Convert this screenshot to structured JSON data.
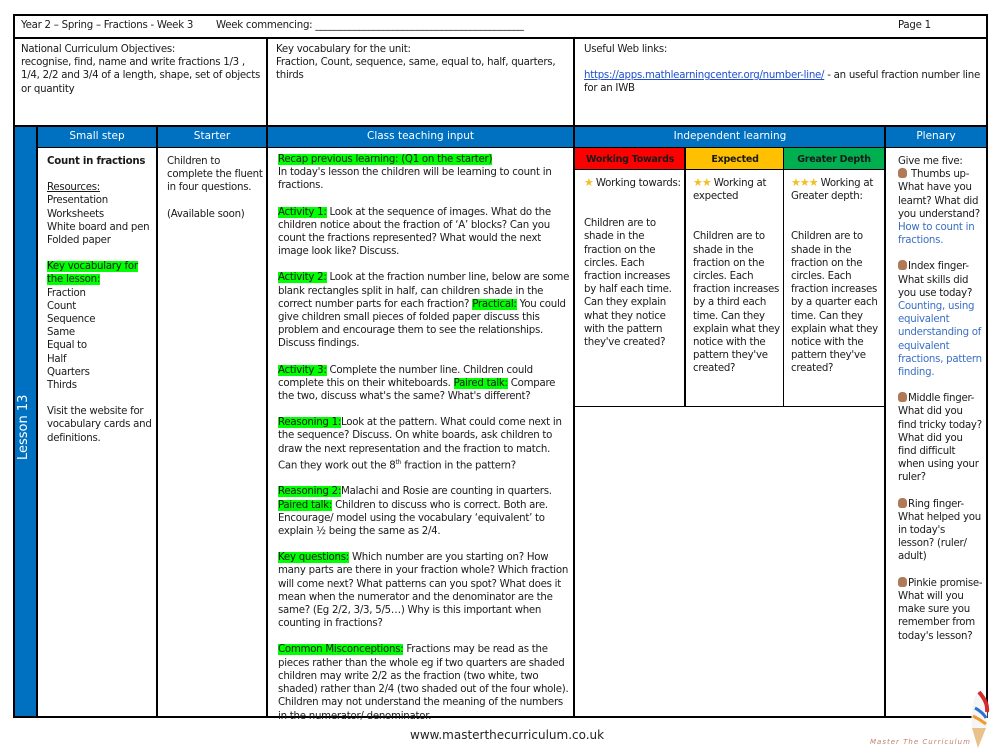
{
  "header": {
    "title": "Year 2 – Spring – Fractions - Week 3",
    "week_commencing_label": "Week commencing: ___________________________________________",
    "page": "Page 1"
  },
  "objectives": {
    "label": "National Curriculum Objectives:",
    "text": "recognise, find, name and write fractions 1/3 , 1/4, 2/2 and 3/4 of a length, shape, set of objects or quantity"
  },
  "unit_vocab": {
    "label": "Key vocabulary for the unit:",
    "text": "Fraction, Count, sequence, same, equal to, half, quarters, thirds"
  },
  "web_links": {
    "label": "Useful Web links:",
    "url": "https://apps.mathlearningcenter.org/number-line/",
    "desc": " - an useful fraction number line for an IWB"
  },
  "lesson_label": "Lesson 13",
  "columns": {
    "small_step": "Small step",
    "starter": "Starter",
    "class_teaching": "Class teaching input",
    "independent": "Independent learning",
    "plenary": "Plenary"
  },
  "small_step": {
    "title": "Count in fractions",
    "resources_label": "Resources:",
    "resources": [
      "Presentation",
      "Worksheets",
      "White board and pen",
      "Folded paper"
    ],
    "vocab_label": "Key vocabulary for the lesson:",
    "vocab": [
      "Fraction",
      "Count",
      "Sequence",
      "Same",
      "Equal to",
      "Half",
      "Quarters",
      "Thirds"
    ],
    "note": "Visit the website for vocabulary cards and definitions."
  },
  "starter": {
    "text": "Children to complete the fluent in four questions.",
    "note": "(Available soon)"
  },
  "teaching": {
    "recap_label": "Recap previous learning: (Q1 on the starter)",
    "recap_text": "In today's lesson the children will be learning to count in fractions.",
    "a1_label": "Activity 1:",
    "a1_text": " Look at the sequence of images. What do the children notice about the fraction of ‘A’ blocks? Can you count the fractions represented? What would the next image look like? Discuss.",
    "a2_label": "Activity 2:",
    "a2_text": " Look at the fraction number line, below are some blank rectangles split in half, can children shade in the correct number parts for each fraction? ",
    "a2_practical_label": "Practical:",
    "a2_practical_text": " You could give children small pieces of folded paper discuss this problem and encourage them to see the relationships. Discuss findings.",
    "a3_label": "Activity 3:",
    "a3_text": " Complete the number line. Children could complete this on their whiteboards. ",
    "a3_paired_label": "Paired talk:",
    "a3_paired_text": " Compare the two, discuss what's the same? What's different?",
    "r1_label": "Reasoning 1:",
    "r1_text_a": "Look at the pattern. What could come next in the sequence? Discuss. On white boards, ask children to draw the next representation and the fraction to match. Can they work out the 8",
    "r1_sup": "th",
    "r1_text_b": " fraction in the pattern?",
    "r2_label": "Reasoning 2:",
    "r2_text": "Malachi and Rosie are counting in quarters. ",
    "r2_paired_label": "Paired talk:",
    "r2_paired_text": " Children to discuss who is correct. Both are. Encourage/ model using the vocabulary ‘equivalent’ to explain ½ being the same as 2/4.",
    "kq_label": "Key questions:",
    "kq_text": " Which number are you starting on? How many parts are there in your fraction whole? Which fraction will come next? What patterns can you spot? What does it mean when the numerator and the denominator are the same? (Eg 2/2, 3/3, 5/5…) Why is this important when counting in fractions?",
    "cm_label": "Common Misconceptions:",
    "cm_text": " Fractions may be read as the pieces rather than the whole eg if two quarters are shaded children may write 2/2 as the fraction (two white, two shaded) rather than 2/4 (two shaded out of the four whole). Children may not understand the meaning of the numbers in the numerator/ denominator."
  },
  "independent": {
    "levels": [
      {
        "label": "Working Towards",
        "color": "#ff0000",
        "stars": "★",
        "intro": "Working towards:",
        "text": "Children are to shade in the fraction on the circles. Each fraction increases by half each time. Can they explain what they notice with the pattern they've created?"
      },
      {
        "label": "Expected",
        "color": "#ffc000",
        "stars": "★★",
        "intro": "Working at expected",
        "text": "Children are to shade in the fraction on the circles. Each fraction increases by a third each time. Can they explain what they notice with the pattern they've created?"
      },
      {
        "label": "Greater Depth",
        "color": "#00b050",
        "stars": "★★★",
        "intro": "Working at Greater depth:",
        "text": "Children are to shade in the fraction on the circles. Each fraction increases by a quarter each time. Can they explain what they notice with the pattern they've created?"
      }
    ]
  },
  "plenary": {
    "intro": "Give me five:",
    "items": [
      {
        "text": "Thumbs up- What have you learnt? What did you understand?",
        "answer": "How to count in fractions."
      },
      {
        "text": "Index finger- What skills did you use today?",
        "answer": "Counting, using equivalent understanding of equivalent fractions, pattern finding."
      },
      {
        "text": "Middle finger- What did you find tricky today? What did you find difficult when using your ruler?",
        "answer": ""
      },
      {
        "text": "Ring finger- What helped you in today's lesson? (ruler/ adult)",
        "answer": ""
      },
      {
        "text": "Pinkie promise- What will you make sure you remember from today's lesson?",
        "answer": ""
      }
    ]
  },
  "footer": {
    "url": "www.masterthecurriculum.co.uk",
    "logo_text": "Master The Curriculum"
  }
}
